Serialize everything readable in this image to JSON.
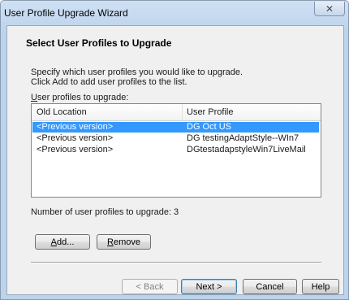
{
  "window": {
    "title": "User Profile Upgrade Wizard",
    "close_glyph": "✕"
  },
  "page": {
    "heading": "Select User Profiles to Upgrade",
    "description_line1": "Specify which user profiles you would like to upgrade.",
    "description_line2": "Click Add to add user profiles to the list.",
    "list_label_mnemonic": "U",
    "list_label_rest": "ser profiles to upgrade:"
  },
  "profiles_list": {
    "columns": [
      "Old Location",
      "User Profile"
    ],
    "rows": [
      {
        "old_location": "<Previous version>",
        "user_profile": "DG Oct US",
        "selected": true
      },
      {
        "old_location": "<Previous version>",
        "user_profile": "DG testingAdaptStyle--WIn7",
        "selected": false
      },
      {
        "old_location": "<Previous version>",
        "user_profile": "DGtestadapstyleWin7LiveMail",
        "selected": false
      }
    ]
  },
  "count": {
    "label": "Number of user profiles to upgrade:",
    "value": "3"
  },
  "buttons": {
    "add": "Add...",
    "remove": "Remove",
    "back": "< Back",
    "next": "Next >",
    "cancel": "Cancel",
    "help": "Help"
  },
  "colors": {
    "selection": "#3399ff"
  }
}
